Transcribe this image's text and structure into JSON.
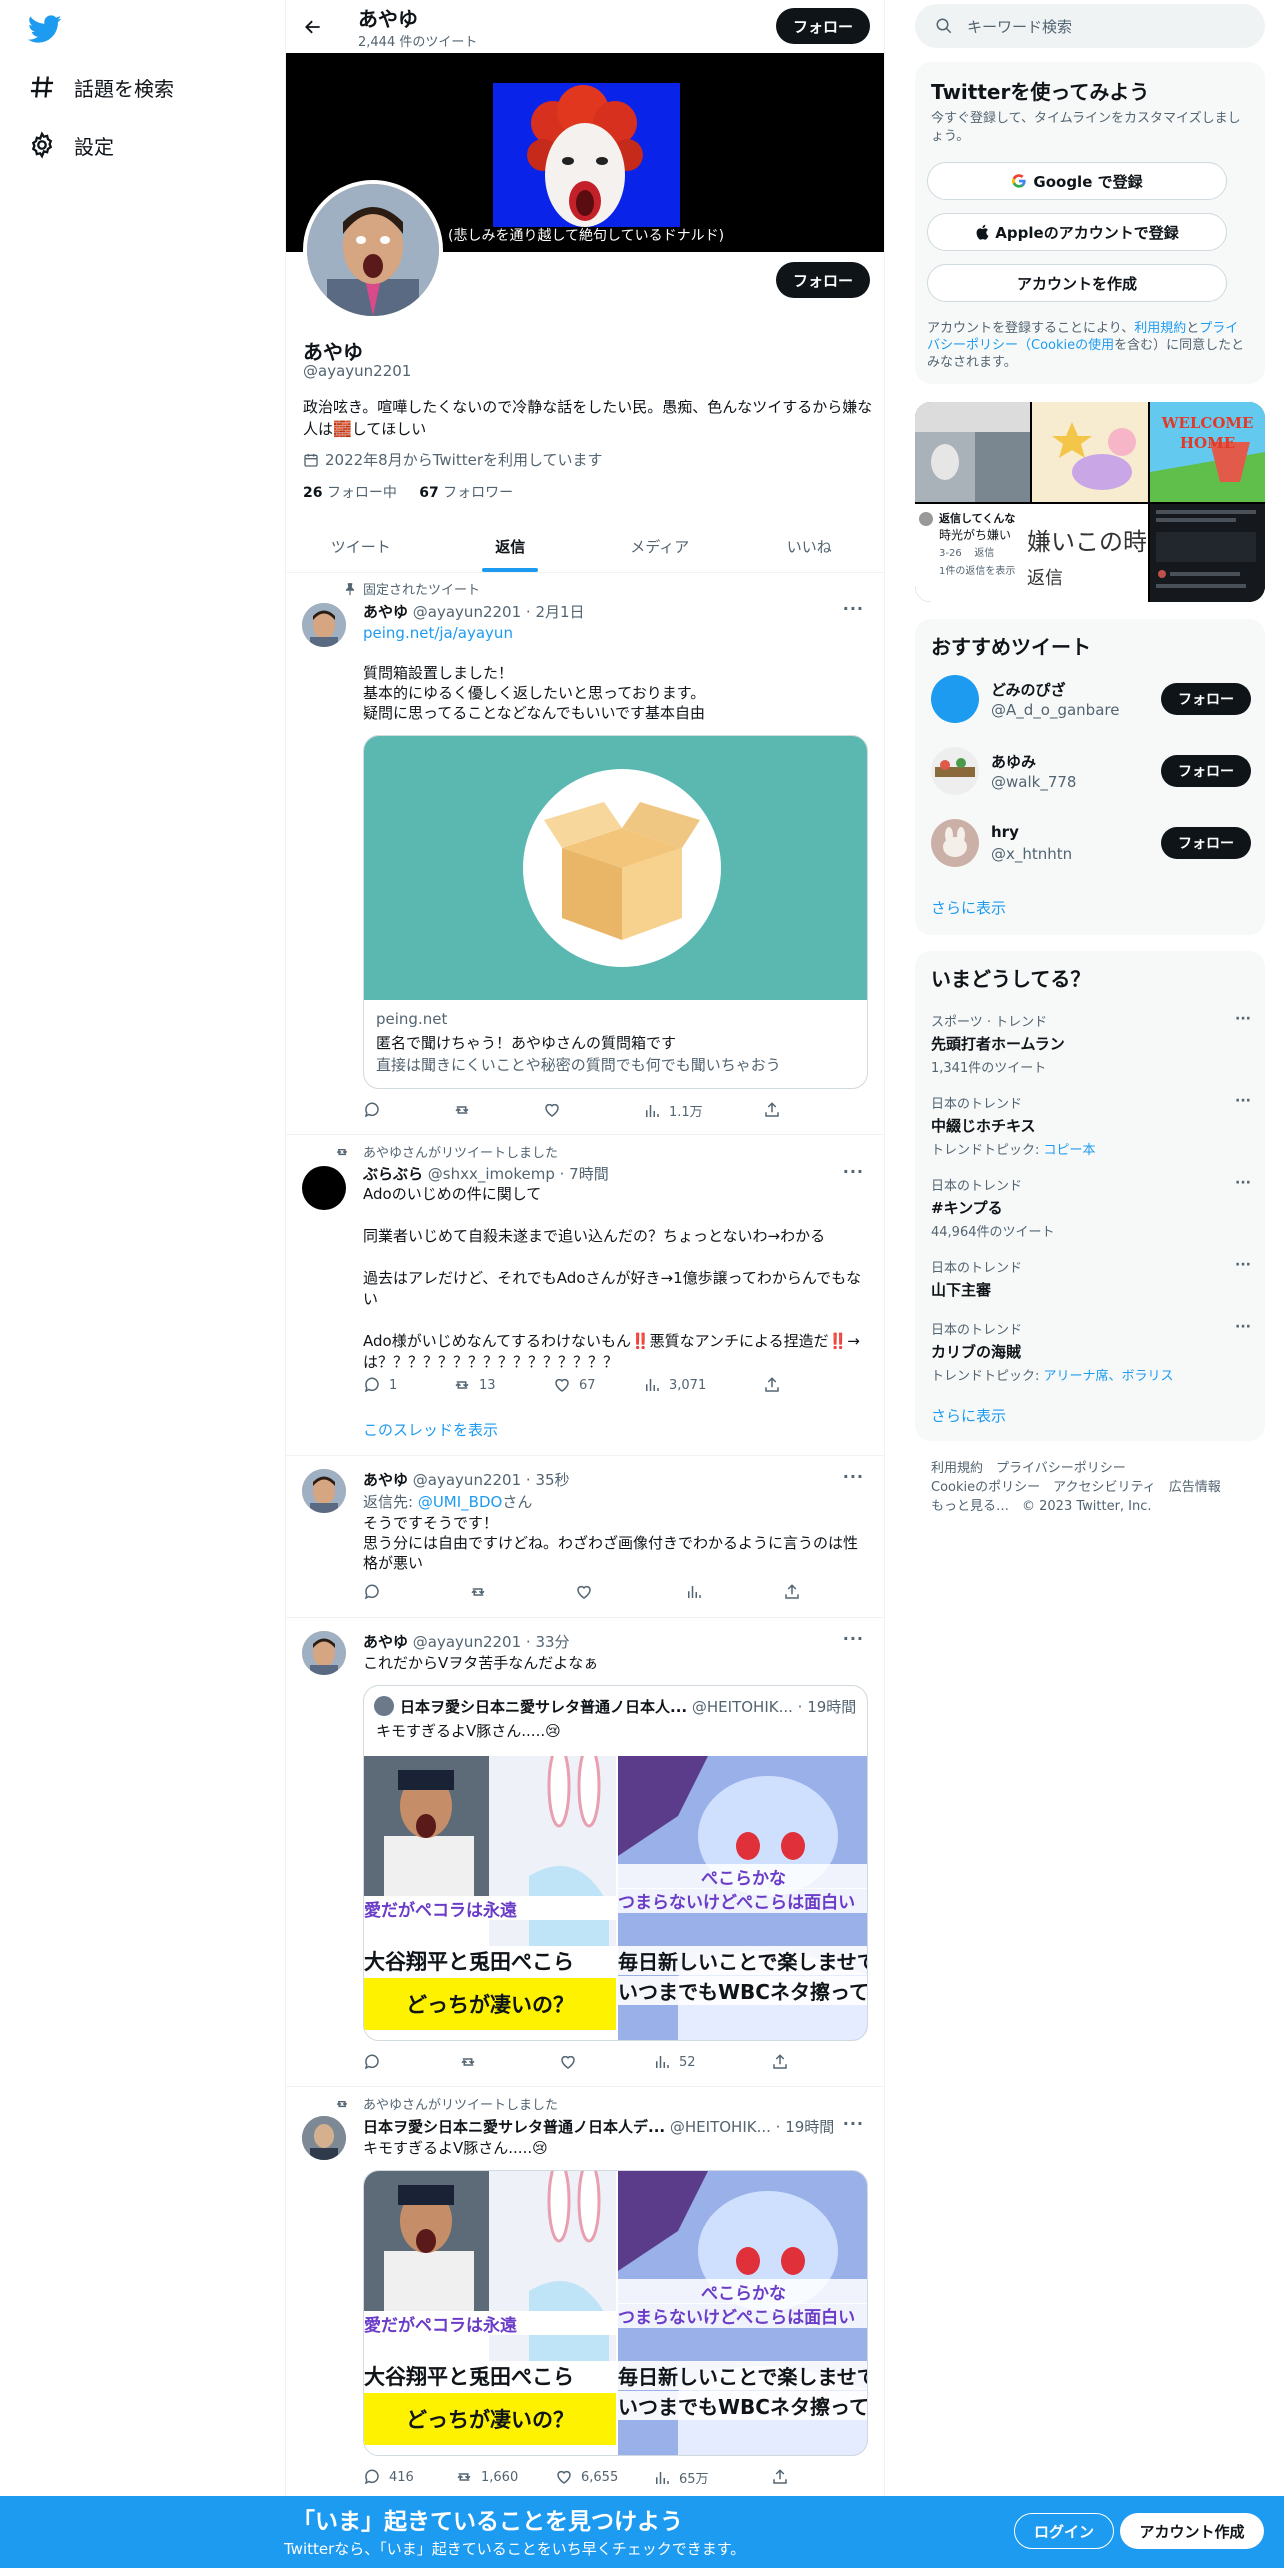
{
  "nav": {
    "explore_label": "話題を検索",
    "settings_label": "設定"
  },
  "header": {
    "title": "あやゆ",
    "tweet_count": "2,444 件のツイート",
    "follow_label": "フォロー"
  },
  "banner": {
    "caption": "(悲しみを通り越して絶句しているドナルド)"
  },
  "profile": {
    "name": "あやゆ",
    "handle": "@ayayun2201",
    "bio": "政治呟き。喧嘩したくないので冷静な話をしたい民。愚痴、色んなツイするから嫌な人は🧱してほしい",
    "joined": "2022年8月からTwitterを利用しています",
    "following_count": "26",
    "following_label": "フォロー中",
    "followers_count": "67",
    "followers_label": "フォロワー",
    "follow_label": "フォロー"
  },
  "tabs": [
    {
      "label": "ツイート"
    },
    {
      "label": "返信"
    },
    {
      "label": "メディア"
    },
    {
      "label": "いいね"
    }
  ],
  "tweets": [
    {
      "context": "固定されたツイート",
      "name": "あやゆ",
      "handle": "@ayayun2201",
      "time": "2月1日",
      "link": "peing.net/ja/ayayun",
      "text": "質問箱設置しました！\n基本的にゆるく優しく返したいと思っております。\n疑問に思ってることなどなんでもいいです基本自由",
      "card_domain": "peing.net",
      "card_title": "匿名で聞けちゃう！あやゆさんの質問箱です",
      "card_desc": "直接は聞きにくいことや秘密の質問でも何でも聞いちゃおう",
      "views": "1.1万"
    },
    {
      "context": "あやゆさんがリツイートしました",
      "name": "ぶらぶら",
      "handle": "@shxx_imokemp",
      "time": "7時間",
      "text": "Adoのいじめの件に関して\n\n同業者いじめて自殺未遂まで追い込んだの？ちょっとないわ→わかる\n\n過去はアレだけど、それでもAdoさんが好き→1億歩譲ってわからんでもない\n\nAdo様がいじめなんてするわけないもん‼️悪質なアンチによる捏造だ‼️→は？？？？？？？？？？？？？？？？",
      "replies": "1",
      "retweets": "13",
      "likes": "67",
      "views": "3,071",
      "show_thread": "このスレッドを表示"
    },
    {
      "name": "あやゆ",
      "handle": "@ayayun2201",
      "time": "35秒",
      "reply_prefix": "返信先: ",
      "reply_to": "@UMI_BDO",
      "reply_suffix": "さん",
      "text": "そうですそうです！\n思う分には自由ですけどね。わざわざ画像付きでわかるように言うのは性格が悪い"
    },
    {
      "name": "あやゆ",
      "handle": "@ayayun2201",
      "time": "33分",
      "text": "これだからVヲタ苦手なんだよなぁ",
      "quote_name": "日本ヲ愛シ日本ニ愛サレタ普通ノ日本人...",
      "quote_handle": "@HEITOHIK...",
      "quote_time": "19時間",
      "quote_text": "キモすぎるよV豚さん.....😢",
      "views": "52"
    },
    {
      "context": "あやゆさんがリツイートしました",
      "name": "日本ヲ愛シ日本ニ愛サレタ普通ノ日本人デ...",
      "handle": "@HEITOHIK...",
      "time": "19時間",
      "text": "キモすぎるよV豚さん.....😢",
      "replies": "416",
      "retweets": "1,660",
      "likes": "6,655",
      "views": "65万"
    }
  ],
  "media_text": {
    "left_top": "愛だがペコラは永遠",
    "left_big1": "大谷翔平と兎田ぺこら",
    "left_big2": "どっちが凄いの？",
    "right_top1": "ぺこらかな",
    "right_top2": "つまらないけどぺこらは面白い",
    "right_big1": "毎日新しいことで楽しませてく",
    "right_big2": "いつまでもWBCネタ擦ってるのは"
  },
  "sidebar": {
    "search_placeholder": "キーワード検索",
    "signup": {
      "title": "Twitterを使ってみよう",
      "desc": "今すぐ登録して、タイムラインをカスタマイズしましょう。",
      "google": "Google で登録",
      "apple": "Appleのアカウントで登録",
      "create": "アカウントを作成",
      "terms_prefix": "アカウントを登録することにより、",
      "terms_link": "利用規約",
      "terms_mid": "と",
      "privacy_link": "プライバシーポリシー",
      "cookie_link": "（Cookieの使用",
      "terms_suffix": "を含む）に同意したとみなされます。"
    },
    "media_labels": {
      "reply_title": "返信してくんな",
      "reply_sub": "時光がち嫌い",
      "reply_date": "3-26",
      "reply_label": "返信",
      "reply_more": "1件の返信を表示",
      "big_text": "嫌いこの時",
      "big_reply": "返信",
      "welcome1": "WELCOME",
      "welcome2": "HOME"
    },
    "recommended": {
      "title": "おすすめツイート",
      "users": [
        {
          "name": "どみのぴざ",
          "handle": "@A_d_o_ganbare",
          "button": "フォロー"
        },
        {
          "name": "あゆみ",
          "handle": "@walk_778",
          "button": "フォロー"
        },
        {
          "name": "hry",
          "handle": "@x_htnhtn",
          "button": "フォロー"
        }
      ],
      "more": "さらに表示"
    },
    "trends": {
      "title": "いまどうしてる？",
      "items": [
        {
          "context": "スポーツ · トレンド",
          "name": "先頭打者ホームラン",
          "extra": "1,341件のツイート"
        },
        {
          "context": "日本のトレンド",
          "name": "中綴じホチキス",
          "extra_prefix": "トレンドトピック: ",
          "extra_link": "コピー本"
        },
        {
          "context": "日本のトレンド",
          "name": "#キンプる",
          "extra": "44,964件のツイート"
        },
        {
          "context": "日本のトレンド",
          "name": "山下主審"
        },
        {
          "context": "日本のトレンド",
          "name": "カリブの海賊",
          "extra_prefix": "トレンドトピック: ",
          "extra_link": "アリーナ席、ボラリス"
        }
      ],
      "more": "さらに表示"
    },
    "footer": {
      "line1": "利用規約　プライバシーポリシー",
      "line2": "Cookieのポリシー　アクセシビリティ　広告情報",
      "line3": "もっと見る…　© 2023 Twitter, Inc."
    }
  },
  "bottom_bar": {
    "title": "「いま」起きていることを見つけよう",
    "subtitle": "Twitterなら、「いま」起きていることをいち早くチェックできます。",
    "login": "ログイン",
    "signup": "アカウント作成"
  },
  "colors": {
    "accent": "#1d9bf0",
    "text": "#0f1419",
    "muted": "#536471",
    "border": "#eff3f4"
  }
}
